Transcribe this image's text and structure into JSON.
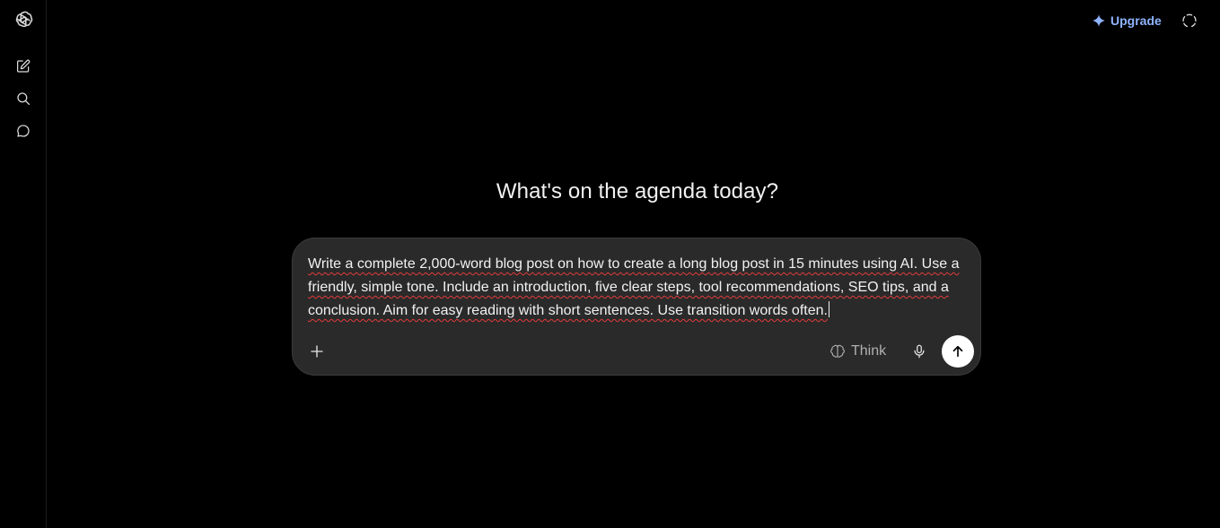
{
  "header": {
    "upgrade_label": "Upgrade",
    "upgrade_color": "#8fb4ff"
  },
  "sidebar": {
    "icons": [
      "openai-logo-icon",
      "new-chat-icon",
      "search-icon",
      "chats-icon"
    ]
  },
  "main": {
    "heading": "What's on the agenda today?"
  },
  "composer": {
    "prompt_text": "Write a complete 2,000-word blog post on how to create a long blog post in 15 minutes using AI. Use a friendly, simple tone. Include an introduction, five clear steps, tool recommendations, SEO tips, and a conclusion. Aim for easy reading with short sentences. Use transition words often.",
    "think_label": "Think",
    "send_button_color": "#ffffff"
  }
}
